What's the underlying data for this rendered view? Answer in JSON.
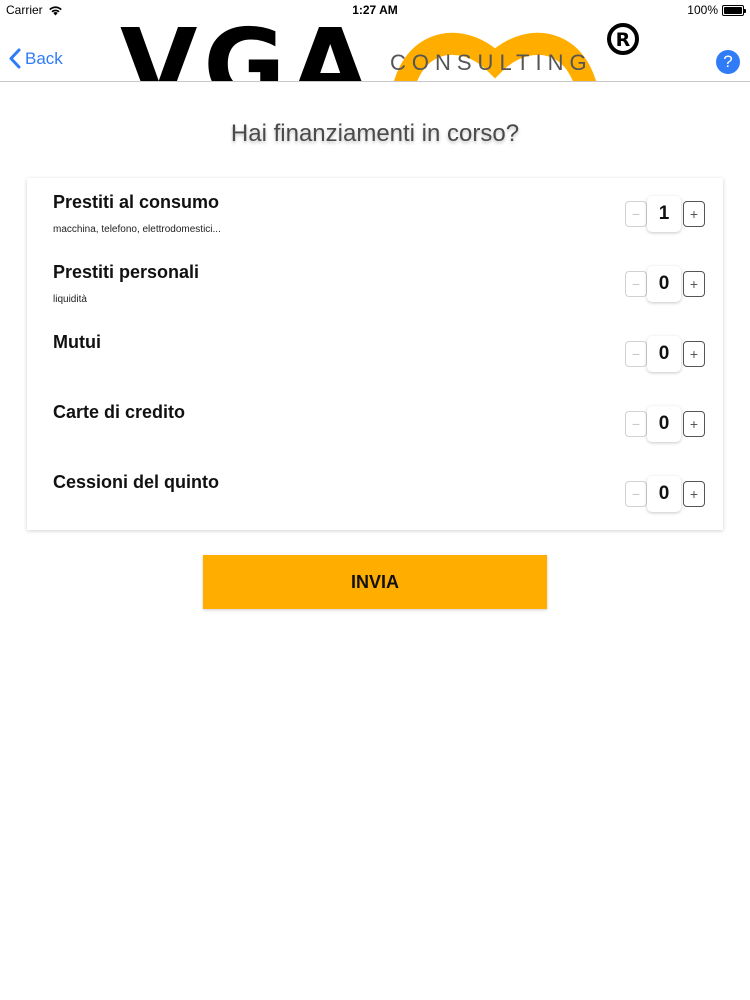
{
  "status_bar": {
    "carrier": "Carrier",
    "time": "1:27 AM",
    "battery": "100%"
  },
  "nav": {
    "back_label": "Back",
    "help_label": "?",
    "logo": {
      "main": "VGA",
      "sub": "CONSULTING",
      "registered": "R"
    }
  },
  "title": "Hai finanziamenti in corso?",
  "rows": [
    {
      "label": "Prestiti al consumo",
      "sub": "macchina, telefono, elettrodomestici...",
      "value": "1"
    },
    {
      "label": "Prestiti personali",
      "sub": "liquidità",
      "value": "0"
    },
    {
      "label": "Mutui",
      "sub": "",
      "value": "0"
    },
    {
      "label": "Carte di credito",
      "sub": "",
      "value": "0"
    },
    {
      "label": "Cessioni del quinto",
      "sub": "",
      "value": "0"
    }
  ],
  "stepper": {
    "minus": "−",
    "plus": "+"
  },
  "submit_label": "INVIA",
  "colors": {
    "accent": "#ffae00",
    "link": "#2f7cf6"
  },
  "icons": {
    "wifi": "wifi-icon",
    "back": "chevron-left-icon",
    "help": "help-icon",
    "battery": "battery-icon"
  }
}
